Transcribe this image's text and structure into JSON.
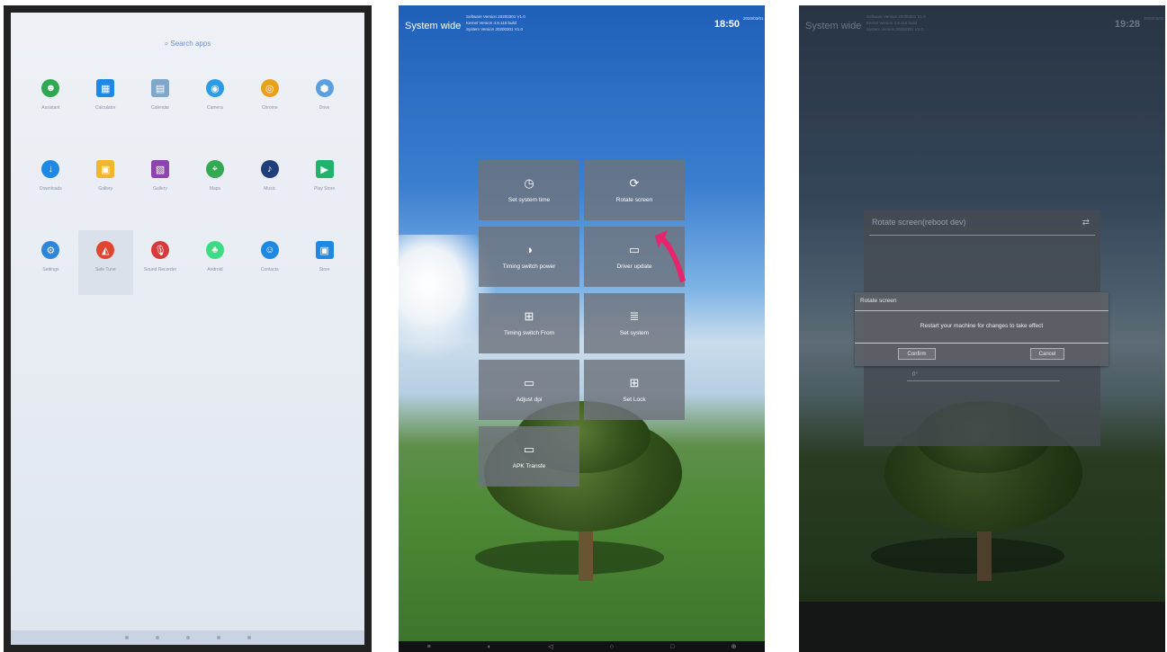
{
  "launcher": {
    "status_text": "",
    "search_label": "Search apps",
    "apps": [
      {
        "label": "Assistant",
        "icon": "assistant-icon",
        "color": "#2fa84f",
        "glyph": "☻"
      },
      {
        "label": "Calculator",
        "icon": "calculator-icon",
        "color": "#1e88e5",
        "glyph": "▦"
      },
      {
        "label": "Calendar",
        "icon": "calendar-icon",
        "color": "#7fa7c9",
        "glyph": "▤"
      },
      {
        "label": "Camera",
        "icon": "camera-icon",
        "color": "#2a9be4",
        "glyph": "◉"
      },
      {
        "label": "Chrome",
        "icon": "chrome-icon",
        "color": "#e8a11a",
        "glyph": "◎"
      },
      {
        "label": "Drive",
        "icon": "drive-icon",
        "color": "#5aa0e0",
        "glyph": "⬢"
      },
      {
        "label": "Downloads",
        "icon": "downloads-icon",
        "color": "#1e88e5",
        "glyph": "↓"
      },
      {
        "label": "Gallery",
        "icon": "gallery-icon",
        "color": "#f1b62a",
        "glyph": "▣"
      },
      {
        "label": "Gallery",
        "icon": "gallery-icon-2",
        "color": "#8e44ad",
        "glyph": "▧"
      },
      {
        "label": "Maps",
        "icon": "maps-icon",
        "color": "#34a853",
        "glyph": "⌖"
      },
      {
        "label": "Music",
        "icon": "music-icon",
        "color": "#1f3f7a",
        "glyph": "♪"
      },
      {
        "label": "Play Store",
        "icon": "play-store-icon",
        "color": "#21b36b",
        "glyph": "▶"
      },
      {
        "label": "Settings",
        "icon": "settings-icon",
        "color": "#2d86d9",
        "glyph": "⚙"
      },
      {
        "label": "Safe Tune",
        "icon": "safe-tune-icon",
        "color": "#e0452f",
        "glyph": "◭"
      },
      {
        "label": "Sound Recorder",
        "icon": "sound-recorder-icon",
        "color": "#d63b3b",
        "glyph": "🎙"
      },
      {
        "label": "Android",
        "icon": "android-icon",
        "color": "#3ddc84",
        "glyph": "♣"
      },
      {
        "label": "Contacts",
        "icon": "contacts-icon",
        "color": "#1e88e5",
        "glyph": "☺"
      },
      {
        "label": "Store",
        "icon": "store-icon",
        "color": "#1e88e5",
        "glyph": "▣"
      }
    ]
  },
  "system": {
    "title": "System wide",
    "info_lines": [
      "Software Version 20200301 V1.0",
      "Kernel Version 4.9.118 build",
      "System Version 20200301 V1.0"
    ],
    "time": "18:50",
    "date": "2020/03/01",
    "tiles": [
      {
        "label": "Set system time",
        "icon": "clock-icon",
        "glyph": "◷"
      },
      {
        "label": "Rotate screen",
        "icon": "rotate-icon",
        "glyph": "⟳"
      },
      {
        "label": "Timing switch power",
        "icon": "timer-icon",
        "glyph": "◑"
      },
      {
        "label": "Driver update",
        "icon": "monitor-icon",
        "glyph": "▭"
      },
      {
        "label": "Timing switch From",
        "icon": "network-icon",
        "glyph": "⊞"
      },
      {
        "label": "Set system",
        "icon": "list-icon",
        "glyph": "≣"
      },
      {
        "label": "Adjust dpi",
        "icon": "display-icon",
        "glyph": "▭"
      },
      {
        "label": "Set Lock",
        "icon": "sitemap-icon",
        "glyph": "⊞"
      },
      {
        "label": "APK Transfe",
        "icon": "apk-icon",
        "glyph": "▭"
      }
    ],
    "nav_glyphs": [
      "≡",
      "◐",
      "◁",
      "○",
      "□",
      "⊕"
    ]
  },
  "dialog_screen": {
    "title": "System wide",
    "info_lines": [
      "Software Version 20200301 V1.0",
      "Kernel Version 4.9.118 build",
      "System Version 20200301 V1.0"
    ],
    "time": "19:28",
    "date": "2020/03/01",
    "back_panel_title": "Rotate screen(reboot dev)",
    "back_panel_sub": "0°",
    "dialog": {
      "title": "Rotate screen",
      "message": "Restart your machine for changes to take effect",
      "confirm": "Confirm",
      "cancel": "Cancel"
    }
  },
  "colors": {
    "accent_arrow": "#e8246c",
    "tile_bg": "#6e737d"
  }
}
